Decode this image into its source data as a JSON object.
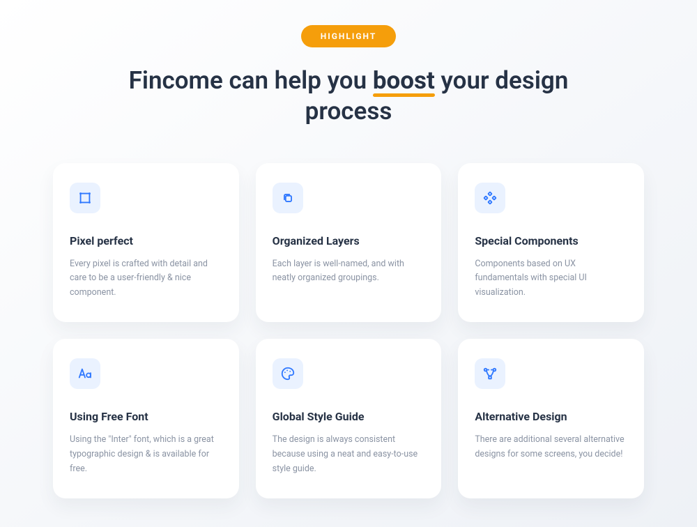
{
  "badge": "HIGHLIGHT",
  "headline_pre": "Fincome can help you ",
  "headline_highlight": "boost",
  "headline_post": " your design process",
  "colors": {
    "accent_orange": "#f59e0b",
    "icon_blue": "#2f78ff",
    "icon_bg": "#eaf2ff",
    "heading": "#263245",
    "body": "#8a93a3"
  },
  "cards": [
    {
      "icon": "crop-icon",
      "title": "Pixel perfect",
      "desc": "Every pixel is crafted with detail and care to be a user-friendly & nice component."
    },
    {
      "icon": "layers-icon",
      "title": "Organized Layers",
      "desc": "Each layer is well-named, and with neatly organized groupings."
    },
    {
      "icon": "components-icon",
      "title": "Special Components",
      "desc": "Components based on UX fundamentals with special UI visualization."
    },
    {
      "icon": "font-icon",
      "title": "Using Free Font",
      "desc": "Using the \"Inter\" font, which is a great typographic design & is available for free."
    },
    {
      "icon": "palette-icon",
      "title": "Global Style Guide",
      "desc": "The design is always consistent because using a neat and easy-to-use style guide."
    },
    {
      "icon": "vector-icon",
      "title": "Alternative Design",
      "desc": "There are additional several alternative designs for some screens, you decide!"
    }
  ]
}
